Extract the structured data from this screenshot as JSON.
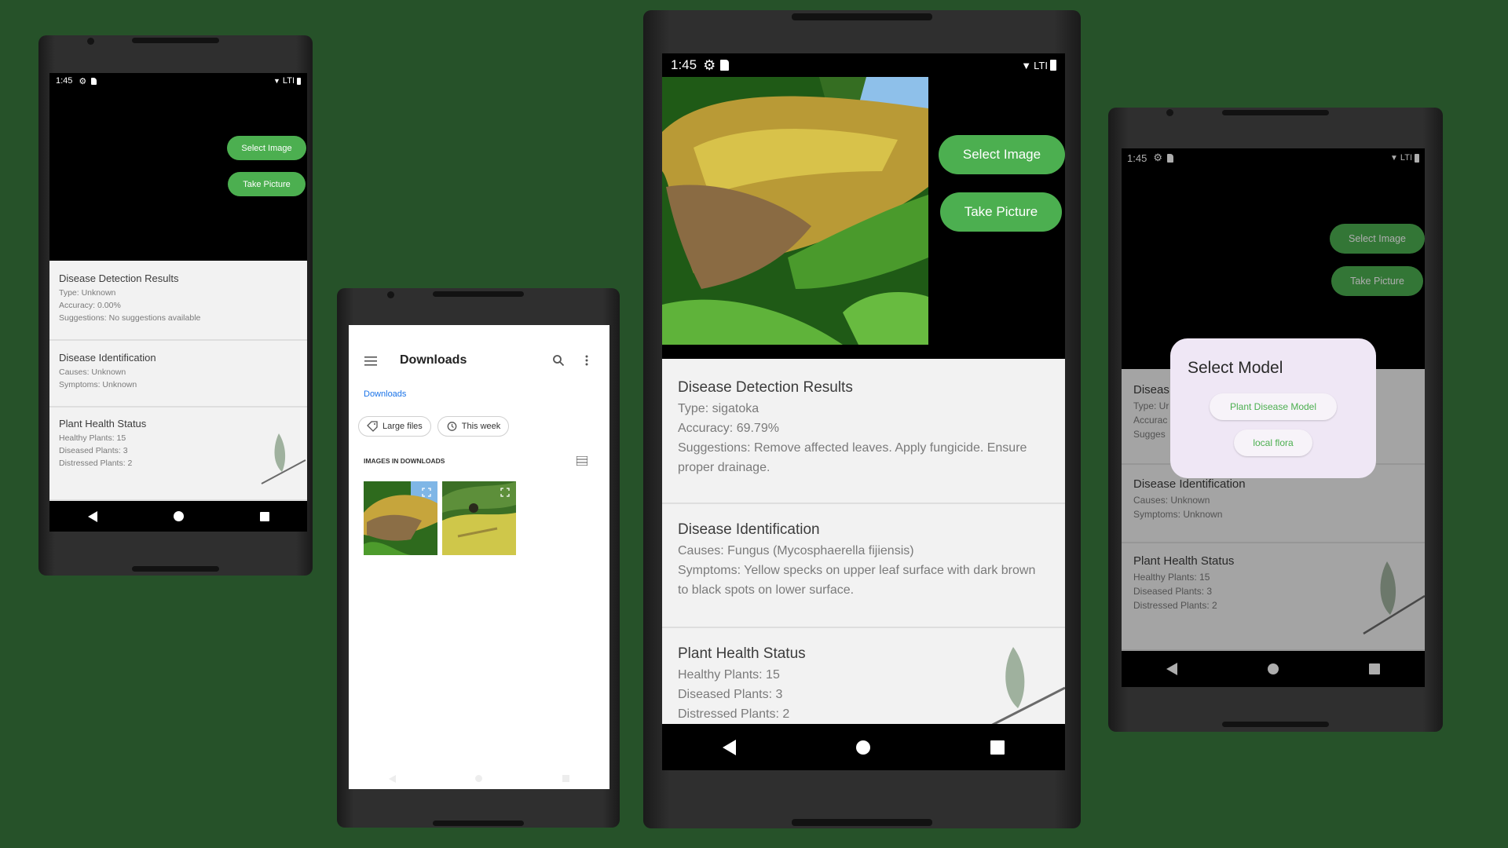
{
  "status_bar": {
    "time": "1:45",
    "network": "LTI"
  },
  "buttons": {
    "select_image": "Select Image",
    "take_picture": "Take Picture"
  },
  "phone1": {
    "detection": {
      "title": "Disease Detection Results",
      "type": "Type: Unknown",
      "accuracy": "Accuracy: 0.00%",
      "suggestions": "Suggestions: No suggestions available"
    },
    "identification": {
      "title": "Disease Identification",
      "causes": "Causes: Unknown",
      "symptoms": "Symptoms: Unknown"
    },
    "health": {
      "title": "Plant Health Status",
      "healthy": "Healthy Plants: 15",
      "diseased": "Diseased Plants: 3",
      "distressed": "Distressed Plants: 2"
    }
  },
  "downloads": {
    "title": "Downloads",
    "breadcrumb": "Downloads",
    "chips": [
      "Large files",
      "This week"
    ],
    "section_header": "IMAGES IN DOWNLOADS"
  },
  "phone3": {
    "detection": {
      "title": "Disease Detection Results",
      "type": "Type: sigatoka",
      "accuracy": "Accuracy: 69.79%",
      "suggestions": "Suggestions: Remove affected leaves. Apply fungicide. Ensure proper drainage."
    },
    "identification": {
      "title": "Disease Identification",
      "causes": "Causes: Fungus (Mycosphaerella fijiensis)",
      "symptoms": "Symptoms: Yellow specks on upper leaf surface with dark brown to black spots on lower surface."
    },
    "health": {
      "title": "Plant Health Status",
      "healthy": "Healthy Plants: 15",
      "diseased": "Diseased Plants: 3",
      "distressed": "Distressed Plants: 2"
    }
  },
  "phone4": {
    "background": {
      "detection_title": "Diseas",
      "type": "Type: Ur",
      "accuracy": "Accurac",
      "suggestions": "Sugges",
      "identification": {
        "title": "Disease Identification",
        "causes": "Causes: Unknown",
        "symptoms": "Symptoms: Unknown"
      },
      "health": {
        "title": "Plant Health Status",
        "healthy": "Healthy Plants: 15",
        "diseased": "Diseased Plants: 3",
        "distressed": "Distressed Plants: 2"
      }
    },
    "dialog": {
      "title": "Select Model",
      "options": [
        "Plant Disease Model",
        "local flora"
      ]
    }
  },
  "colors": {
    "background": "#265229",
    "accent_green": "#4caf50",
    "card_bg": "#f2f2f2",
    "dialog_bg": "#efe7f5",
    "link_blue": "#1a73e8"
  }
}
